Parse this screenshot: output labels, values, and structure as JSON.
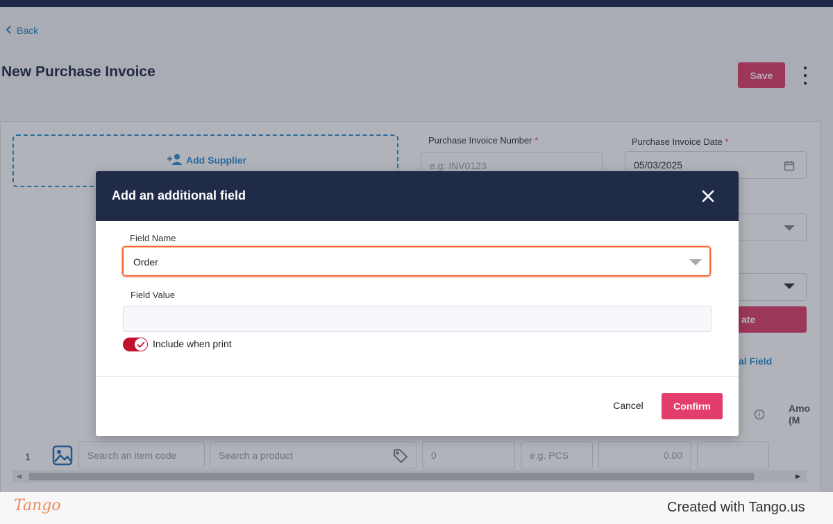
{
  "page": {
    "back_label": "Back",
    "title": "New Purchase Invoice",
    "save_label": "Save"
  },
  "form": {
    "add_supplier_label": "Add Supplier",
    "invoice_number_label": "Purchase Invoice Number",
    "invoice_number_placeholder": "e.g: INV0123",
    "invoice_date_label": "Purchase Invoice Date",
    "invoice_date_value": "05/03/2025",
    "required_mark": "*",
    "partial_button_text": "ate",
    "partial_additional_field_link": "al Field"
  },
  "table": {
    "amount_header_line1": "Amo",
    "amount_header_line2": "(M",
    "row_number": "1",
    "item_code_placeholder": "Search an item code",
    "product_placeholder": "Search a product",
    "quantity_value": "0",
    "unit_placeholder": "e.g. PCS",
    "price_value": "0.00"
  },
  "modal": {
    "title": "Add an additional field",
    "field_name_label": "Field Name",
    "field_name_value": "Order",
    "field_value_label": "Field Value",
    "field_value_value": "",
    "include_when_print_label": "Include when print",
    "include_when_print_enabled": true,
    "cancel_label": "Cancel",
    "confirm_label": "Confirm"
  },
  "footer": {
    "logo_text": "Tango",
    "created_with": "Created with Tango.us"
  },
  "colors": {
    "primary_pink": "#e23d6b",
    "modal_header": "#202b48",
    "link_blue": "#2d8fd5",
    "focus_orange": "#f26a3a",
    "toggle_red": "#c0102c"
  },
  "icons": [
    "chevron-left-icon",
    "more-vertical-icon",
    "add-person-icon",
    "calendar-icon",
    "chevron-down-icon",
    "info-icon",
    "image-icon",
    "tag-icon",
    "close-icon",
    "check-icon"
  ]
}
